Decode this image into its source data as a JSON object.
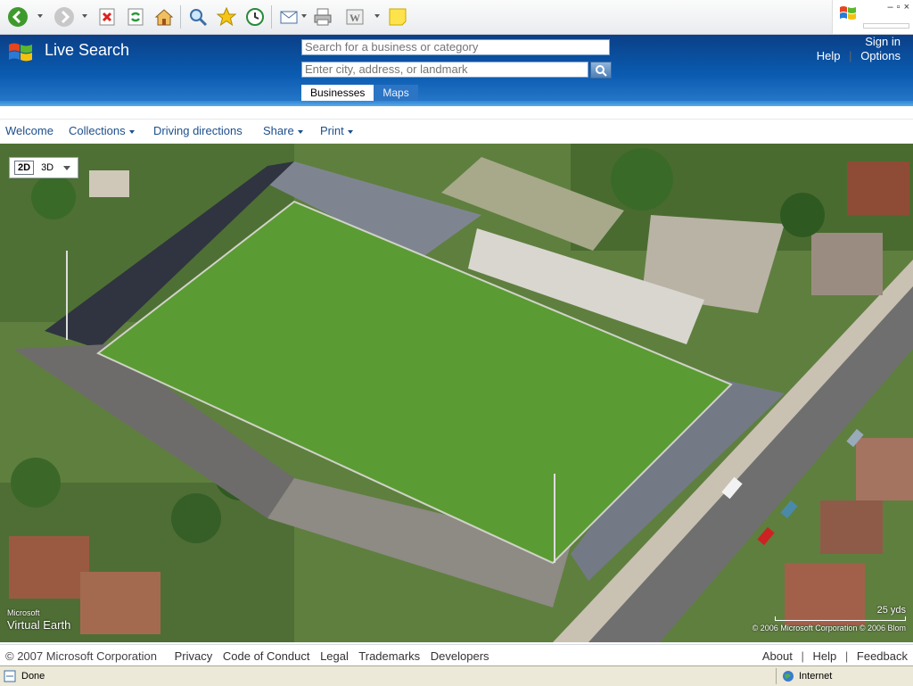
{
  "browser": {
    "toolbar_icons": [
      "back-icon",
      "forward-icon",
      "stop-icon",
      "refresh-icon",
      "home-icon",
      "search-icon",
      "favorites-icon",
      "history-icon",
      "mail-icon",
      "print-icon",
      "edit-icon",
      "note-icon"
    ]
  },
  "header": {
    "brand": "Live Search",
    "search_placeholder": "Search for a business or category",
    "where_placeholder": "Enter city, address, or landmark",
    "tabs": [
      {
        "label": "Businesses",
        "active": true
      },
      {
        "label": "Maps",
        "active": false
      }
    ],
    "sign_in": "Sign in",
    "help": "Help",
    "pipe": "|",
    "options": "Options"
  },
  "menu": {
    "items": [
      {
        "label": "Welcome",
        "dropdown": false
      },
      {
        "label": "Collections",
        "dropdown": true
      },
      {
        "label": "Driving directions",
        "dropdown": false
      },
      {
        "label": "Share",
        "dropdown": true
      },
      {
        "label": "Print",
        "dropdown": true
      }
    ]
  },
  "map": {
    "dim_2d": "2D",
    "dim_3d": "3D",
    "logo_microsoft": "Microsoft",
    "logo_ve": "Virtual Earth",
    "scale_label": "25 yds",
    "copyright": "© 2006 Microsoft Corporation  © 2006 Blom"
  },
  "footer": {
    "copyright": "© 2007 Microsoft Corporation",
    "links_left": [
      "Privacy",
      "Code of Conduct",
      "Legal",
      "Trademarks",
      "Developers"
    ],
    "about": "About",
    "help": "Help",
    "feedback": "Feedback",
    "pipe": "|"
  },
  "status": {
    "text": "Done",
    "zone": "Internet"
  }
}
